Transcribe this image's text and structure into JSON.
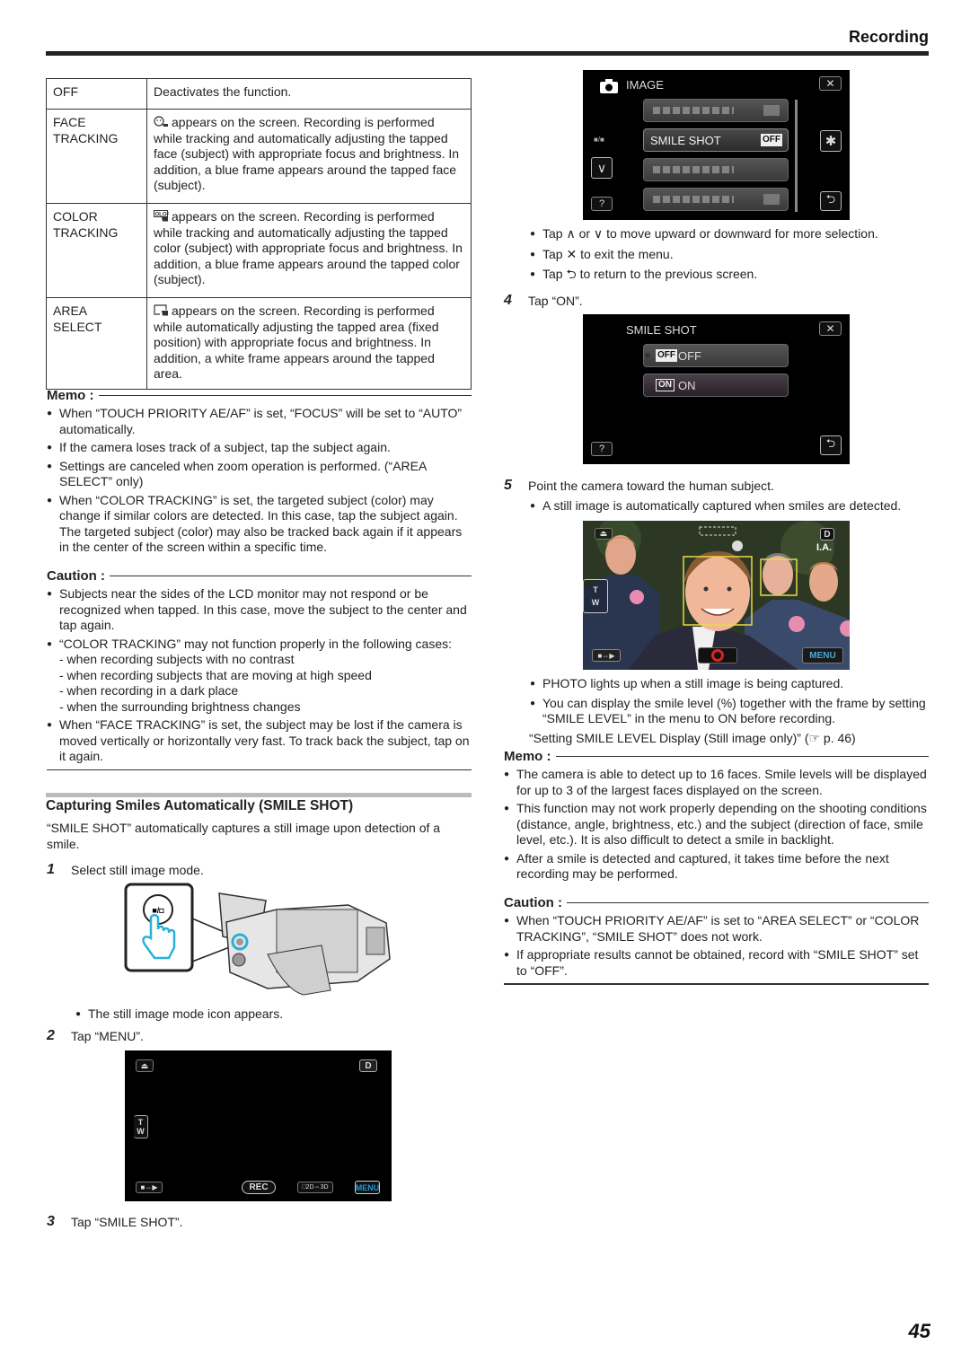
{
  "header": {
    "section_title": "Recording"
  },
  "options_table": [
    {
      "key": "OFF",
      "icon": "",
      "desc": "Deactivates the function."
    },
    {
      "key": "FACE TRACKING",
      "icon": "face-tracking-icon",
      "desc": "appears on the screen. Recording is performed while tracking and automatically adjusting the tapped face (subject) with appropriate focus and brightness. In addition, a blue frame appears around the tapped face (subject)."
    },
    {
      "key": "COLOR TRACKING",
      "icon": "color-tracking-icon",
      "desc": "appears on the screen. Recording is performed while tracking and automatically adjusting the tapped color (subject) with appropriate focus and brightness. In addition, a blue frame appears around the tapped color (subject)."
    },
    {
      "key": "AREA SELECT",
      "icon": "area-select-icon",
      "desc": "appears on the screen. Recording is performed while automatically adjusting the tapped area (fixed position) with appropriate focus and brightness. In addition, a white frame appears around the tapped area."
    }
  ],
  "memo1": {
    "title": "Memo :",
    "items": [
      "When “TOUCH PRIORITY AE/AF” is set, “FOCUS” will be set to “AUTO” automatically.",
      "If the camera loses track of a subject, tap the subject again.",
      "Settings are canceled when zoom operation is performed. (“AREA SELECT” only)",
      "When “COLOR TRACKING” is set, the targeted subject (color) may change if similar colors are detected. In this case, tap the subject again. The targeted subject (color) may also be tracked back again if it appears in the center of the screen within a specific time."
    ]
  },
  "caution1": {
    "title": "Caution :",
    "items": [
      "Subjects near the sides of the LCD monitor may not respond or be recognized when tapped. In this case, move the subject to the center and tap again.",
      "“COLOR TRACKING” may not function properly in the following cases:",
      "When “FACE TRACKING” is set, the subject may be lost if the camera is moved vertically or horizontally very fast. To track back the subject, tap on it again."
    ],
    "sub_items": [
      "- when recording subjects with no contrast",
      "- when recording subjects that are moving at high speed",
      "- when recording in a dark place",
      "- when the surrounding brightness changes"
    ]
  },
  "section": {
    "heading": "Capturing Smiles Automatically (SMILE SHOT)",
    "intro": "“SMILE SHOT” automatically captures a still image upon detection of a smile."
  },
  "steps": [
    {
      "num": "1",
      "text": "Select still image mode."
    },
    {
      "num": "2",
      "text": "Tap “MENU”."
    },
    {
      "num": "3",
      "text": "Tap “SMILE SHOT”."
    },
    {
      "num": "4",
      "text": "Tap “ON”."
    },
    {
      "num": "5",
      "text": "Point the camera toward the human subject."
    }
  ],
  "step1_note": "The still image mode icon appears.",
  "step3_notes": [
    "Tap ∧ or ∨ to move upward or downward for more selection.",
    "Tap ✕ to exit the menu.",
    "Tap ⮌ to return to the previous screen."
  ],
  "step5_notes": [
    "A still image is automatically captured when smiles are detected.",
    "PHOTO lights up when a still image is being captured.",
    "You can display the smile level (%) together with the frame by setting “SMILE LEVEL” in the menu to ON before recording."
  ],
  "step5_ref": "“Setting SMILE LEVEL Display (Still image only)” (☞ p. 46)",
  "memo2": {
    "title": "Memo :",
    "items": [
      "The camera is able to detect up to 16 faces. Smile levels will be displayed for up to 3 of the largest faces displayed on the screen.",
      "This function may not work properly depending on the shooting conditions (distance, angle, brightness, etc.) and the subject (direction of face, smile level, etc.). It is also difficult to detect a smile in backlight.",
      "After a smile is detected and captured, it takes time before the next recording may be performed."
    ]
  },
  "caution2": {
    "title": "Caution :",
    "items": [
      "When “TOUCH PRIORITY AE/AF” is set to “AREA SELECT” or “COLOR TRACKING”, “SMILE SHOT” does not work.",
      "If appropriate results cannot be obtained, record with “SMILE SHOT” set to “OFF”."
    ]
  },
  "screen_rec": {
    "d_label": "D",
    "t_label": "T",
    "w_label": "W",
    "rec_label": "REC",
    "mode_label": "□2D⇔3D",
    "menu_label": "MENU",
    "menu_color": "#1e9be0"
  },
  "screen_image_menu": {
    "title": "IMAGE",
    "highlighted_item": "SMILE SHOT",
    "highlighted_value": "OFF",
    "page_indicator": "■/■",
    "help_label": "?"
  },
  "screen_smile_shot": {
    "title": "SMILE SHOT",
    "options": [
      {
        "badge": "OFF",
        "label": "OFF",
        "selected": true
      },
      {
        "badge": "ON",
        "label": "ON",
        "selected": false
      }
    ],
    "help_label": "?"
  },
  "screen_live": {
    "d_label": "D",
    "ia_label": "I.A.",
    "t_label": "T",
    "w_label": "W",
    "menu_label": "MENU",
    "face_frame_color": "#e8d84a"
  },
  "page_number": "45"
}
